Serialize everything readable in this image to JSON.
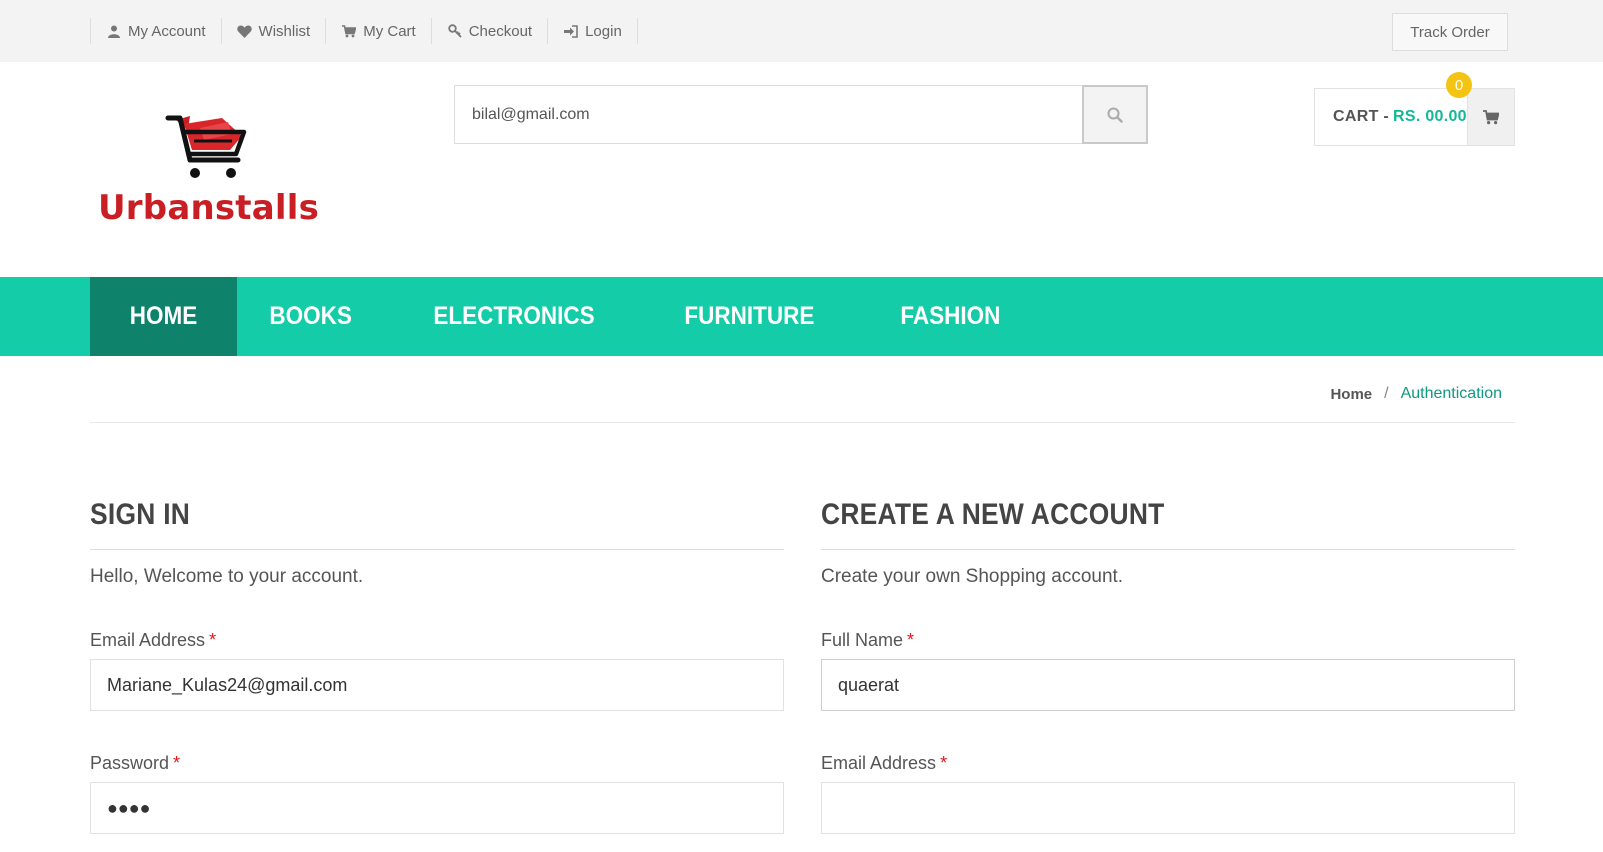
{
  "topbar": {
    "links": [
      {
        "label": "My Account",
        "icon": "user-icon"
      },
      {
        "label": "Wishlist",
        "icon": "heart-icon"
      },
      {
        "label": "My Cart",
        "icon": "cart-icon"
      },
      {
        "label": "Checkout",
        "icon": "key-icon"
      },
      {
        "label": "Login",
        "icon": "sign-in-icon"
      }
    ],
    "track_order": "Track Order"
  },
  "header": {
    "logo_text": "Urbanstalls",
    "search": {
      "value": "bilal@gmail.com",
      "placeholder": ""
    },
    "cart": {
      "label": "CART -",
      "total": "RS. 00.00",
      "count": "0"
    }
  },
  "nav": {
    "items": [
      "HOME",
      "BOOKS",
      "ELECTRONICS",
      "FURNITURE",
      "FASHION"
    ],
    "active": "HOME"
  },
  "breadcrumb": {
    "home": "Home",
    "separator": "/",
    "current": "Authentication"
  },
  "sign_in": {
    "title": "SIGN IN",
    "subtitle": "Hello, Welcome to your account.",
    "email_label": "Email Address",
    "email_value": "Mariane_Kulas24@gmail.com",
    "password_label": "Password",
    "password_value": "●●●●",
    "required_mark": "*"
  },
  "create_account": {
    "title": "CREATE A NEW ACCOUNT",
    "subtitle": "Create your own Shopping account.",
    "fullname_label": "Full Name",
    "fullname_value": "quaerat",
    "email_label": "Email Address",
    "email_value": "",
    "required_mark": "*"
  },
  "colors": {
    "accent": "#14cca8",
    "nav_active": "#0f826b",
    "brand_red": "#c91e23",
    "badge": "#f5c312"
  }
}
